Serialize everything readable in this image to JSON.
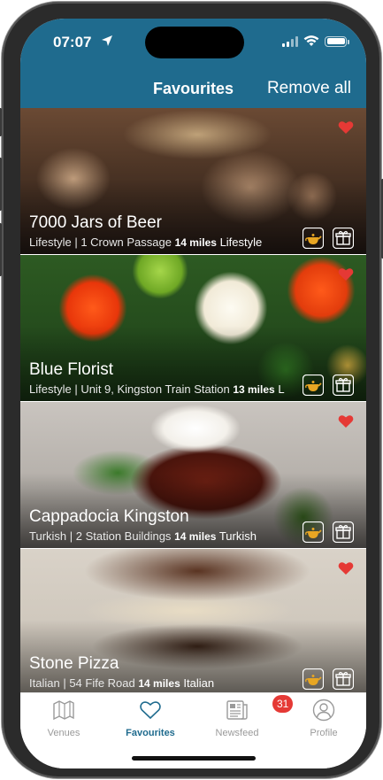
{
  "status_bar": {
    "time": "07:07"
  },
  "header": {
    "title": "Favourites",
    "action_label": "Remove all"
  },
  "venues": [
    {
      "name": "7000 Jars of Beer",
      "category": "Lifestyle",
      "address": "1 Crown Passage",
      "distance": "14 miles",
      "category_tag": "Lifestyle"
    },
    {
      "name": "Blue Florist",
      "category": "Lifestyle",
      "address": "Unit 9, Kingston Train Station",
      "distance": "13 miles",
      "category_tag": "L"
    },
    {
      "name": "Cappadocia Kingston",
      "category": "Turkish",
      "address": "2 Station Buildings",
      "distance": "14 miles",
      "category_tag": "Turkish"
    },
    {
      "name": "Stone Pizza",
      "category": "Italian",
      "address": "54 Fife Road",
      "distance": "14 miles",
      "category_tag": "Italian"
    }
  ],
  "card_icons": [
    "heart-icon",
    "teapot-icon",
    "gift-icon"
  ],
  "tabs": [
    {
      "label": "Venues",
      "icon": "map-icon",
      "active": false
    },
    {
      "label": "Favourites",
      "icon": "heart-outline-icon",
      "active": true
    },
    {
      "label": "Newsfeed",
      "icon": "newspaper-icon",
      "active": false,
      "badge": "31"
    },
    {
      "label": "Profile",
      "icon": "profile-icon",
      "active": false
    }
  ],
  "colors": {
    "header_bg": "#1f6b8e",
    "tab_active": "#1f6b8e",
    "heart": "#e53935",
    "badge": "#e53935",
    "teapot": "#e8a623"
  }
}
